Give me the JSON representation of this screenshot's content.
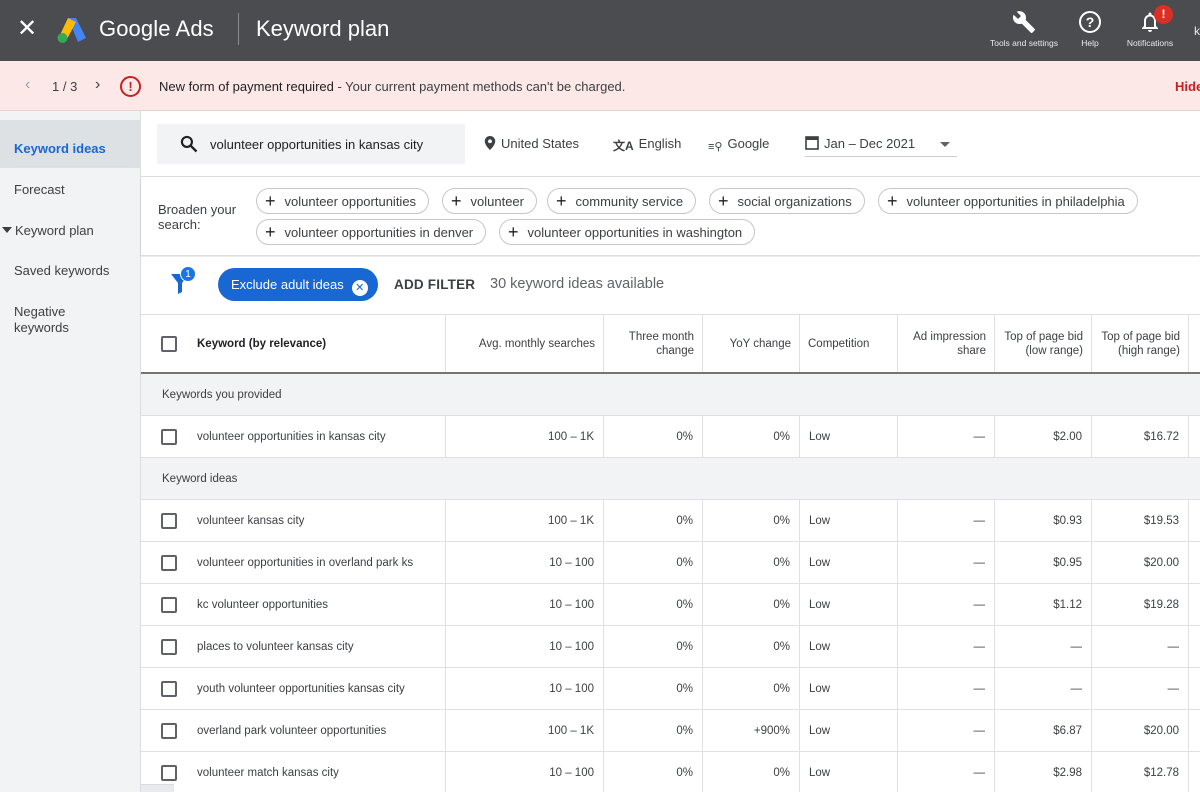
{
  "topbar": {
    "close_icon": "close-icon",
    "brand": "Google Ads",
    "page_title": "Keyword plan",
    "actions": [
      {
        "label": "Tools and settings",
        "icon": "wrench-icon"
      },
      {
        "label": "Help",
        "icon": "help-circle-icon"
      },
      {
        "label": "Notifications",
        "icon": "bell-icon",
        "badge": "!"
      }
    ],
    "cut_text": "k"
  },
  "alert": {
    "prev_icon": "chevron-left-icon",
    "pager": "1 / 3",
    "next_icon": "chevron-right-icon",
    "icon": "error-circle-icon",
    "icon_glyph": "!",
    "title": "New form of payment required",
    "message": " - Your current payment methods can't be charged.",
    "hide_label": "Hide",
    "colors": {
      "background": "#fce8e6",
      "accent": "#c5221f"
    }
  },
  "sidebar": {
    "items": [
      {
        "label": "Keyword ideas",
        "active": true
      },
      {
        "label": "Forecast"
      },
      {
        "label": "Keyword plan",
        "expandable": true
      },
      {
        "label": "Saved keywords"
      },
      {
        "label": "Negative keywords"
      }
    ]
  },
  "search": {
    "query": "volunteer opportunities in kansas city",
    "location": "United States",
    "language": "English",
    "network": "Google",
    "date_range": "Jan – Dec 2021"
  },
  "broaden": {
    "label": "Broaden your search:",
    "chips": [
      "volunteer opportunities",
      "volunteer",
      "community service",
      "social organizations",
      "volunteer opportunities in philadelphia",
      "volunteer opportunities in denver",
      "volunteer opportunities in washington"
    ]
  },
  "filters": {
    "badge_count": "1",
    "active_filter": "Exclude adult ideas",
    "add_filter_label": "ADD FILTER",
    "ideas_count_text": "30 keyword ideas available",
    "accent": "#1967d2"
  },
  "table": {
    "columns": [
      "Keyword (by relevance)",
      "Avg. monthly searches",
      "Three month change",
      "YoY change",
      "Competition",
      "Ad impression share",
      "Top of page bid (low range)",
      "Top of page bid (high range)"
    ],
    "sections": [
      {
        "title": "Keywords you provided",
        "rows": [
          {
            "keyword": "volunteer opportunities in kansas city",
            "searches": "100 – 1K",
            "three_month": "0%",
            "yoy": "0%",
            "competition": "Low",
            "impression_share": "—",
            "bid_low": "$2.00",
            "bid_high": "$16.72"
          }
        ]
      },
      {
        "title": "Keyword ideas",
        "rows": [
          {
            "keyword": "volunteer kansas city",
            "searches": "100 – 1K",
            "three_month": "0%",
            "yoy": "0%",
            "competition": "Low",
            "impression_share": "—",
            "bid_low": "$0.93",
            "bid_high": "$19.53"
          },
          {
            "keyword": "volunteer opportunities in overland park ks",
            "searches": "10 – 100",
            "three_month": "0%",
            "yoy": "0%",
            "competition": "Low",
            "impression_share": "—",
            "bid_low": "$0.95",
            "bid_high": "$20.00"
          },
          {
            "keyword": "kc volunteer opportunities",
            "searches": "10 – 100",
            "three_month": "0%",
            "yoy": "0%",
            "competition": "Low",
            "impression_share": "—",
            "bid_low": "$1.12",
            "bid_high": "$19.28"
          },
          {
            "keyword": "places to volunteer kansas city",
            "searches": "10 – 100",
            "three_month": "0%",
            "yoy": "0%",
            "competition": "Low",
            "impression_share": "—",
            "bid_low": "—",
            "bid_high": "—"
          },
          {
            "keyword": "youth volunteer opportunities kansas city",
            "searches": "10 – 100",
            "three_month": "0%",
            "yoy": "0%",
            "competition": "Low",
            "impression_share": "—",
            "bid_low": "—",
            "bid_high": "—"
          },
          {
            "keyword": "overland park volunteer opportunities",
            "searches": "100 – 1K",
            "three_month": "0%",
            "yoy": "+900%",
            "competition": "Low",
            "impression_share": "—",
            "bid_low": "$6.87",
            "bid_high": "$20.00"
          },
          {
            "keyword": "volunteer match kansas city",
            "searches": "10 – 100",
            "three_month": "0%",
            "yoy": "0%",
            "competition": "Low",
            "impression_share": "—",
            "bid_low": "$2.98",
            "bid_high": "$12.78"
          }
        ]
      }
    ]
  }
}
